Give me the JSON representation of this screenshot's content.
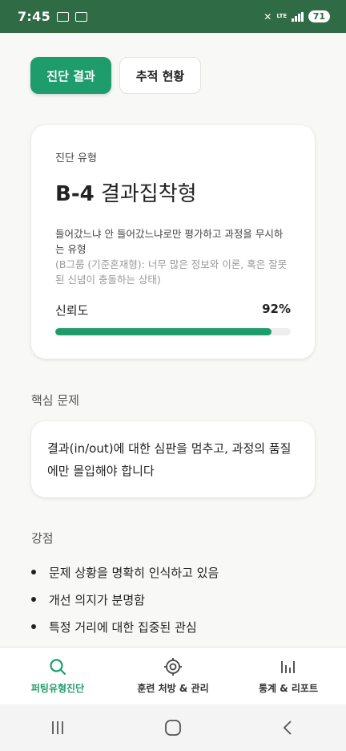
{
  "status": {
    "time": "7:45",
    "lte": "LTE",
    "battery": "71"
  },
  "tabs": [
    {
      "label": "진단 결과"
    },
    {
      "label": "추적 현황"
    }
  ],
  "result": {
    "label": "진단 유형",
    "code": "B-4",
    "name": "결과집착형",
    "description": "들어갔느냐 안 들어갔느냐로만 평가하고 과정을 무시하는 유형",
    "sub_description": "(B그룹 (기준혼재형): 너무 많은 정보와 이론, 혹은 잘못된 신념이 충돌하는 상태)",
    "confidence_label": "신뢰도",
    "confidence_value": "92%",
    "confidence_fraction": 0.92
  },
  "core": {
    "title": "핵심 문제",
    "text": "결과(in/out)에 대한 심판을 멈추고, 과정의 품질에만 몰입해야 합니다"
  },
  "strengths": {
    "title": "강점",
    "items": [
      "문제 상황을 명확히 인식하고 있음",
      "개선 의지가 분명함",
      "특정 거리에 대한 집중된 관심"
    ]
  },
  "bottom_nav": [
    {
      "label": "퍼팅유형진단",
      "icon": "search-icon"
    },
    {
      "label": "훈련 처방 & 관리",
      "icon": "target-icon"
    },
    {
      "label": "통계 & 리포트",
      "icon": "bar-chart-icon"
    }
  ],
  "colors": {
    "accent": "#1f9c6c",
    "status_bar": "#2f6b45"
  }
}
